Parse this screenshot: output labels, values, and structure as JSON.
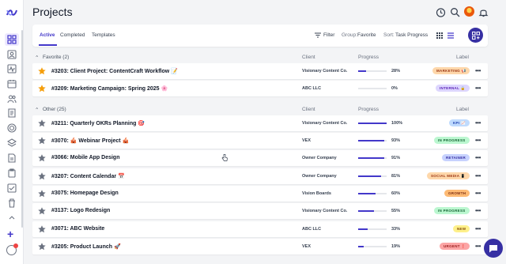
{
  "header": {
    "title": "Projects"
  },
  "sidebar": {
    "icons": [
      "grid-icon",
      "contact-icon",
      "activity-icon",
      "calendar-icon",
      "users-icon",
      "invoice-icon",
      "target-icon",
      "layers-icon",
      "document-icon",
      "clipboard-icon",
      "checklist-icon",
      "trash-icon"
    ]
  },
  "toolbar": {
    "tabs": [
      "Active",
      "Completed",
      "Templates"
    ],
    "filter": "Filter",
    "group_prefix": "Group:",
    "group_value": "Favorite",
    "sort_prefix": "Sort:",
    "sort_value": "Task Progress"
  },
  "columns": {
    "client": "Client",
    "progress": "Progress",
    "label": "Label"
  },
  "groups": [
    {
      "title": "Favorite (2)",
      "rows": [
        {
          "name": "#3203: Client Project: ContentCraft Workflow 📝",
          "client": "Visionary Content Co.",
          "progress": 0.28,
          "pct": "28%",
          "label": "MARKETING 📢",
          "label_bg": "#fed7aa",
          "label_fg": "#9a3412",
          "starred": true
        },
        {
          "name": "#3209: Marketing Campaign: Spring 2025 🌸",
          "client": "ABC LLC",
          "progress": 0,
          "pct": "0%",
          "label": "INTERNAL 🔒",
          "label_bg": "#ddd6fe",
          "label_fg": "#5b21b6",
          "starred": true
        }
      ]
    },
    {
      "title": "Other (25)",
      "rows": [
        {
          "name": "#3211: Quarterly OKRs Planning 🎯",
          "client": "Visionary Content Co.",
          "progress": 1.0,
          "pct": "100%",
          "label": "KPI 📈",
          "label_bg": "#bfdbfe",
          "label_fg": "#1e40af",
          "starred": false
        },
        {
          "name": "#3070: 🎪 Webinar Project 🎪",
          "client": "VEX",
          "progress": 0.93,
          "pct": "93%",
          "label": "IN PROGRESS",
          "label_bg": "#bbf7d0",
          "label_fg": "#166534",
          "starred": false
        },
        {
          "name": "#3066: Mobile App Design",
          "client": "Owner Company",
          "progress": 0.91,
          "pct": "91%",
          "label": "RETAINER",
          "label_bg": "#c7d2fe",
          "label_fg": "#3730a3",
          "starred": false
        },
        {
          "name": "#3207: Content Calendar 📅",
          "client": "Owner Company",
          "progress": 0.81,
          "pct": "81%",
          "label": "SOCIAL MEDIA 📱",
          "label_bg": "#fed7aa",
          "label_fg": "#9a3412",
          "starred": false
        },
        {
          "name": "#3075: Homepage Design",
          "client": "Vision Boards",
          "progress": 0.6,
          "pct": "60%",
          "label": "GROWTH",
          "label_bg": "#fdba74",
          "label_fg": "#7c2d12",
          "starred": false
        },
        {
          "name": "#3137: Logo Redesign",
          "client": "Visionary Content Co.",
          "progress": 0.55,
          "pct": "55%",
          "label": "IN PROGRESS",
          "label_bg": "#bbf7d0",
          "label_fg": "#166534",
          "starred": false
        },
        {
          "name": "#3071: ABC Website",
          "client": "ABC LLC",
          "progress": 0.33,
          "pct": "33%",
          "label": "NEW",
          "label_bg": "#fef08a",
          "label_fg": "#854d0e",
          "starred": false
        },
        {
          "name": "#3205: Product Launch 🚀",
          "client": "VEX",
          "progress": 0.19,
          "pct": "19%",
          "label": "URGENT ❗",
          "label_bg": "#fca5a5",
          "label_fg": "#991b1b",
          "starred": false
        }
      ]
    }
  ],
  "colors": {
    "accent": "#4338ca",
    "star_on": "#f59e0b",
    "star_off": "#6b7280"
  }
}
